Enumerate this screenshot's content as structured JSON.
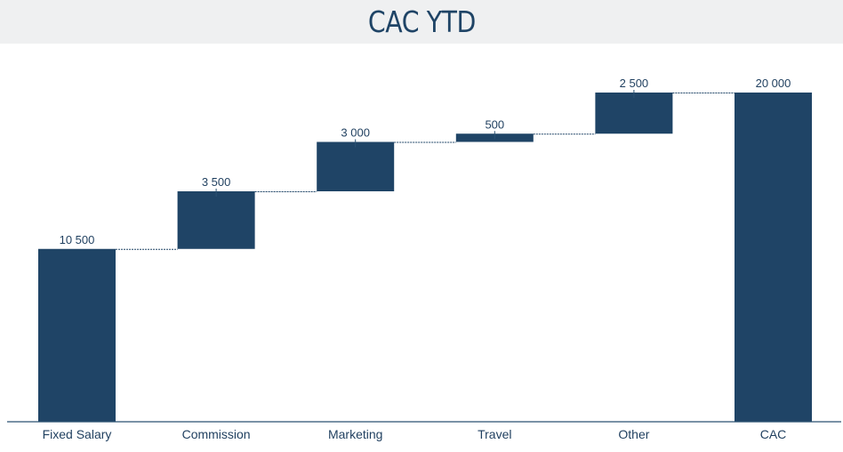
{
  "title": "CAC YTD",
  "colors": {
    "bar": "#1f4466",
    "axis": "#2b5172",
    "connector": "#1f4466",
    "label": "#1f3f5f",
    "title_bg": "#eff0f1"
  },
  "chart_data": {
    "type": "bar",
    "subtype": "waterfall",
    "title": "CAC YTD",
    "xlabel": "",
    "ylabel": "",
    "ylim": [
      0,
      20000
    ],
    "grid": false,
    "legend": "none",
    "categories": [
      "Fixed Salary",
      "Commission",
      "Marketing",
      "Travel",
      "Other",
      "CAC"
    ],
    "values": [
      10500,
      3500,
      3000,
      500,
      2500,
      20000
    ],
    "data_labels": [
      "10 500",
      "3 500",
      "3 000",
      "500",
      "2 500",
      "20 000"
    ],
    "is_total": [
      false,
      false,
      false,
      false,
      false,
      true
    ]
  }
}
